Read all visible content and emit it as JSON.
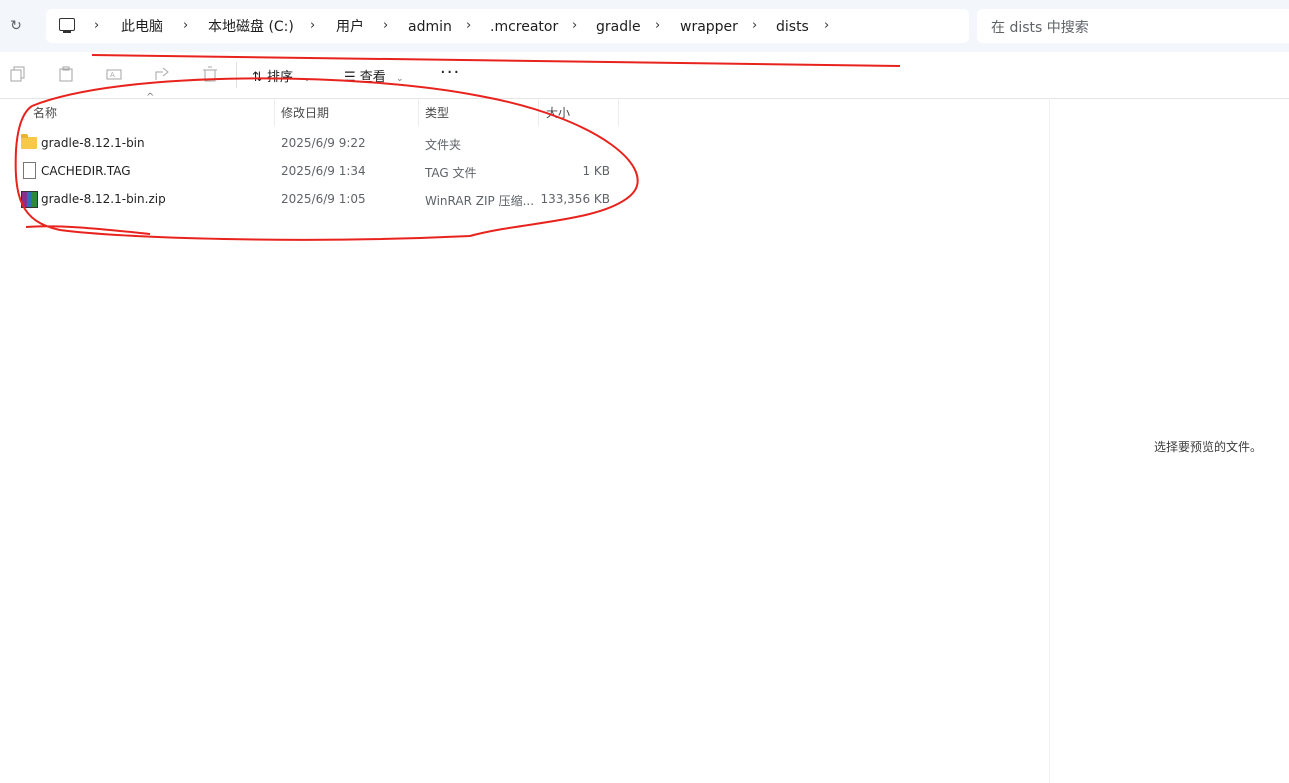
{
  "addressbar": {
    "refresh_icon": "refresh-icon",
    "computer_icon": "computer-icon",
    "breadcrumbs": [
      "此电脑",
      "本地磁盘 (C:)",
      "用户",
      "admin",
      ".mcreator",
      "gradle",
      "wrapper",
      "dists"
    ],
    "search_placeholder": "在 dists 中搜索"
  },
  "toolbar": {
    "sort_label": "排序",
    "view_label": "查看",
    "more_label": "···"
  },
  "columns": {
    "name": "名称",
    "modified": "修改日期",
    "type": "类型",
    "size": "大小"
  },
  "files": [
    {
      "name": "gradle-8.12.1-bin",
      "modified": "2025/6/9 9:22",
      "type": "文件夹",
      "size": "",
      "icon": "folder-icon"
    },
    {
      "name": "CACHEDIR.TAG",
      "modified": "2025/6/9 1:34",
      "type": "TAG 文件",
      "size": "1 KB",
      "icon": "file-icon"
    },
    {
      "name": "gradle-8.12.1-bin.zip",
      "modified": "2025/6/9 1:05",
      "type": "WinRAR ZIP 压缩...",
      "size": "133,356 KB",
      "icon": "winrar-zip-icon"
    }
  ],
  "preview": {
    "empty_text": "选择要预览的文件。"
  },
  "annotation_color": "#e8231d"
}
